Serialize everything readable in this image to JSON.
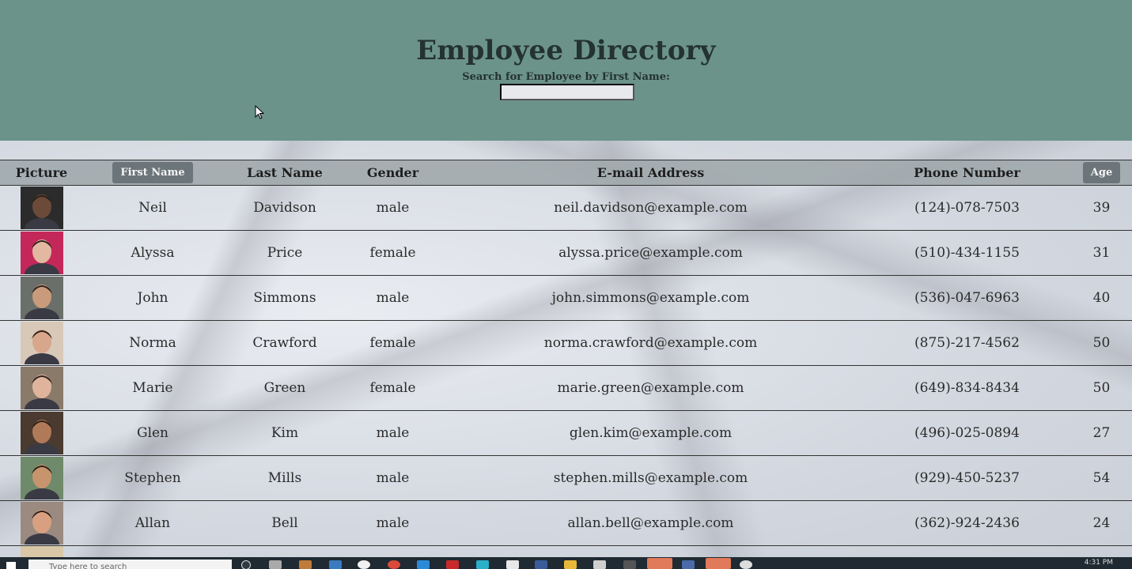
{
  "header": {
    "title": "Employee Directory",
    "search_label": "Search for Employee by First Name:",
    "search_value": ""
  },
  "table": {
    "columns": {
      "picture": "Picture",
      "first_name": "First Name",
      "last_name": "Last Name",
      "gender": "Gender",
      "email": "E-mail Address",
      "phone": "Phone Number",
      "age": "Age"
    },
    "rows": [
      {
        "first": "Neil",
        "last": "Davidson",
        "gender": "male",
        "email": "neil.davidson@example.com",
        "phone": "(124)-078-7503",
        "age": "39",
        "bg": "#2b2b2b",
        "skin": "#6b4a3a"
      },
      {
        "first": "Alyssa",
        "last": "Price",
        "gender": "female",
        "email": "alyssa.price@example.com",
        "phone": "(510)-434-1155",
        "age": "31",
        "bg": "#c4285a",
        "skin": "#e2b8a0"
      },
      {
        "first": "John",
        "last": "Simmons",
        "gender": "male",
        "email": "john.simmons@example.com",
        "phone": "(536)-047-6963",
        "age": "40",
        "bg": "#6b6f6a",
        "skin": "#c99a7c"
      },
      {
        "first": "Norma",
        "last": "Crawford",
        "gender": "female",
        "email": "norma.crawford@example.com",
        "phone": "(875)-217-4562",
        "age": "50",
        "bg": "#d8c8b8",
        "skin": "#d8a68a"
      },
      {
        "first": "Marie",
        "last": "Green",
        "gender": "female",
        "email": "marie.green@example.com",
        "phone": "(649)-834-8434",
        "age": "50",
        "bg": "#8a7a6a",
        "skin": "#e0b49c"
      },
      {
        "first": "Glen",
        "last": "Kim",
        "gender": "male",
        "email": "glen.kim@example.com",
        "phone": "(496)-025-0894",
        "age": "27",
        "bg": "#4a3a30",
        "skin": "#b07a58"
      },
      {
        "first": "Stephen",
        "last": "Mills",
        "gender": "male",
        "email": "stephen.mills@example.com",
        "phone": "(929)-450-5237",
        "age": "54",
        "bg": "#6f8a6a",
        "skin": "#c8946e"
      },
      {
        "first": "Allan",
        "last": "Bell",
        "gender": "male",
        "email": "allan.bell@example.com",
        "phone": "(362)-924-2436",
        "age": "24",
        "bg": "#9a8a80",
        "skin": "#d8a080"
      }
    ]
  },
  "taskbar": {
    "search_placeholder": "Type here to search",
    "time": "4:31 PM"
  }
}
